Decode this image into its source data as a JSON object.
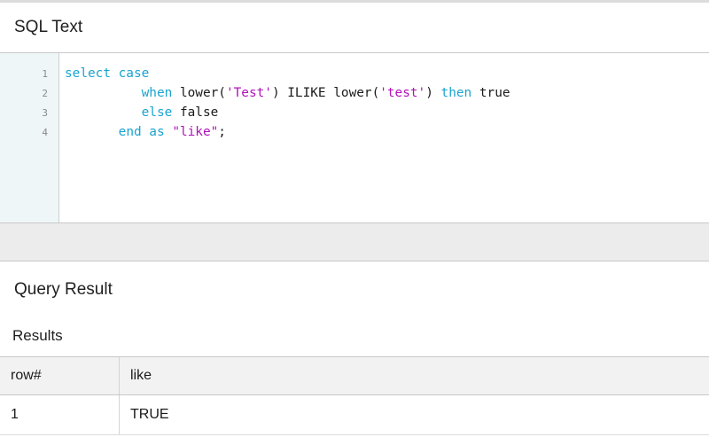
{
  "sql_panel": {
    "title": "SQL Text",
    "line_numbers": [
      "1",
      "2",
      "3",
      "4"
    ]
  },
  "result_panel": {
    "title": "Query Result",
    "results_label": "Results"
  },
  "results_table": {
    "columns": [
      "row#",
      "like"
    ],
    "rows": [
      [
        "1",
        "TRUE"
      ]
    ]
  },
  "colors": {
    "keyword": "#1aa3cf",
    "string": "#b012b8",
    "gutter_bg": "#eef6f8"
  }
}
